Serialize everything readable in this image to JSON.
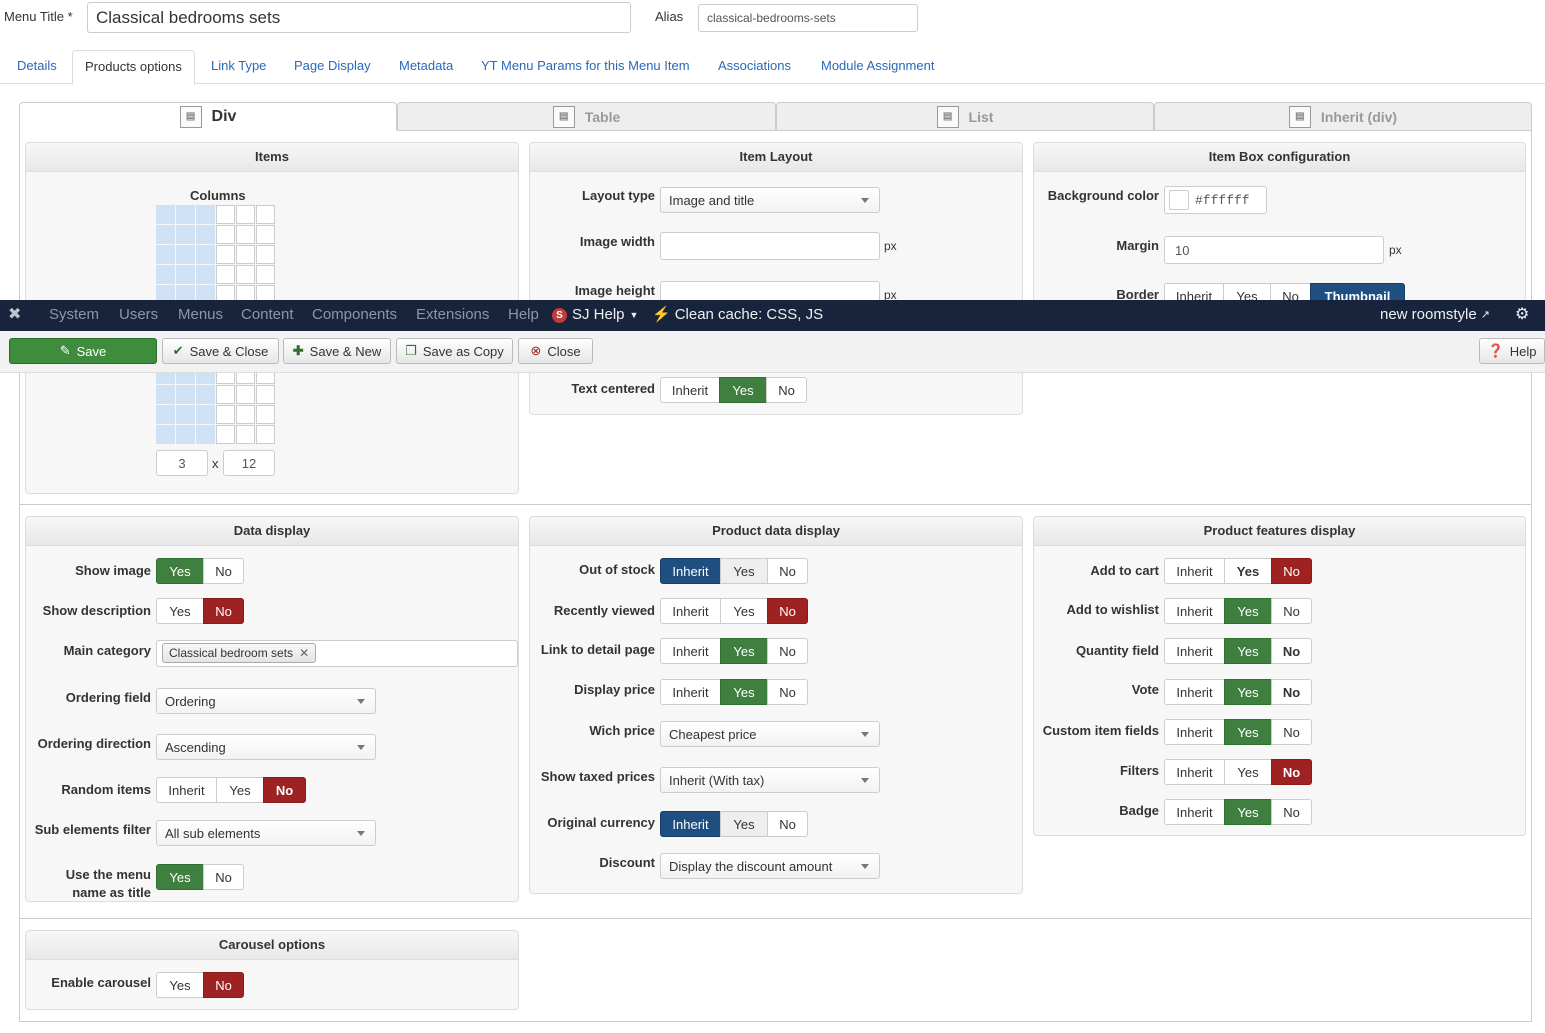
{
  "header": {
    "menu_title_label": "Menu Title *",
    "menu_title_value": "Classical bedrooms sets",
    "alias_label": "Alias",
    "alias_value": "classical-bedrooms-sets"
  },
  "tabs": [
    "Details",
    "Products options",
    "Link Type",
    "Page Display",
    "Metadata",
    "YT Menu Params for this Menu Item",
    "Associations",
    "Module Assignment"
  ],
  "layout_tabs": [
    "Div",
    "Table",
    "List",
    "Inherit (div)"
  ],
  "items_panel": {
    "title": "Items",
    "columns_label": "Columns",
    "cols_value": "3",
    "x_label": "x",
    "rows_value": "12"
  },
  "item_layout": {
    "title": "Item Layout",
    "layout_type_label": "Layout type",
    "layout_type_value": "Image and title",
    "image_width_label": "Image width",
    "image_height_label": "Image height",
    "px": "px",
    "text_centered_label": "Text centered",
    "text_centered_options": [
      "Inherit",
      "Yes",
      "No"
    ]
  },
  "item_box": {
    "title": "Item Box configuration",
    "bg_color_label": "Background color",
    "bg_color_value": "#ffffff",
    "margin_label": "Margin",
    "margin_value": "10",
    "px": "px",
    "border_label": "Border",
    "border_options": [
      "Inherit",
      "Yes",
      "No",
      "Thumbnail"
    ]
  },
  "navbar": {
    "items": [
      "System",
      "Users",
      "Menus",
      "Content",
      "Components",
      "Extensions",
      "Help"
    ],
    "sj_help": "SJ Help",
    "clean_cache": "Clean cache: CSS, JS",
    "site_name": "new roomstyle"
  },
  "toolbar": {
    "save": "Save",
    "save_close": "Save & Close",
    "save_new": "Save & New",
    "save_copy": "Save as Copy",
    "close": "Close",
    "help": "Help"
  },
  "data_display": {
    "title": "Data display",
    "show_image_label": "Show image",
    "show_description_label": "Show description",
    "main_category_label": "Main category",
    "main_category_chip": "Classical bedroom sets",
    "ordering_field_label": "Ordering field",
    "ordering_field_value": "Ordering",
    "ordering_direction_label": "Ordering direction",
    "ordering_direction_value": "Ascending",
    "random_items_label": "Random items",
    "sub_elements_label": "Sub elements filter",
    "sub_elements_value": "All sub elements",
    "use_menu_name_label": "Use the menu name as title",
    "yes": "Yes",
    "no": "No",
    "inherit": "Inherit"
  },
  "product_data": {
    "title": "Product data display",
    "out_of_stock_label": "Out of stock",
    "recently_viewed_label": "Recently viewed",
    "link_detail_label": "Link to detail page",
    "display_price_label": "Display price",
    "wich_price_label": "Wich price",
    "wich_price_value": "Cheapest price",
    "show_taxed_label": "Show taxed prices",
    "show_taxed_value": "Inherit (With tax)",
    "original_currency_label": "Original currency",
    "discount_label": "Discount",
    "discount_value": "Display the discount amount"
  },
  "product_features": {
    "title": "Product features display",
    "add_to_cart_label": "Add to cart",
    "add_to_wishlist_label": "Add to wishlist",
    "quantity_field_label": "Quantity field",
    "vote_label": "Vote",
    "custom_fields_label": "Custom item fields",
    "filters_label": "Filters",
    "badge_label": "Badge"
  },
  "carousel": {
    "title": "Carousel options",
    "enable_label": "Enable carousel"
  },
  "colors": {
    "green": "#3f7f3f",
    "red": "#9e2222",
    "blue": "#1e4f80",
    "navbar": "#17243b",
    "link": "#2a69b8"
  }
}
